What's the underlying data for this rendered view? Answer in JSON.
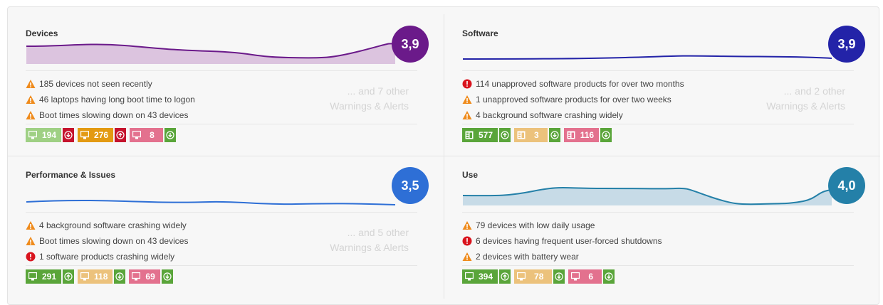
{
  "colors": {
    "devices_score": "#6b1a8a",
    "software_score": "#2323a8",
    "performance_score": "#2e6fd6",
    "use_score": "#2480a8",
    "warning": "#ef8b1c",
    "error": "#d9141e",
    "green": "#5aa53a",
    "light_green": "#9fd084",
    "orange": "#e39a12",
    "pink": "#e3718e",
    "light_orange": "#ecc27c",
    "red": "#c5132d"
  },
  "cards": [
    {
      "title": "Devices",
      "score": "3,9",
      "alerts": [
        {
          "level": "warning",
          "icon": "warning-icon",
          "text": "185 devices not seen recently"
        },
        {
          "level": "warning",
          "icon": "warning-icon",
          "text": "46 laptops having long boot time to logon"
        },
        {
          "level": "warning",
          "icon": "warning-icon",
          "text": "Boot times slowing down on 43 devices"
        }
      ],
      "more_count": "... and 7 other",
      "more_label": "Warnings & Alerts",
      "badges": [
        {
          "value": "194",
          "icon": "device-icon",
          "trend": "down",
          "trend_icon": "arrow-down-circle-icon",
          "color": "#9fd084",
          "trend_color": "#c5132d"
        },
        {
          "value": "276",
          "icon": "device-icon",
          "trend": "up",
          "trend_icon": "arrow-up-circle-icon",
          "color": "#e39a12",
          "trend_color": "#c5132d"
        },
        {
          "value": "8",
          "icon": "device-icon",
          "trend": "down",
          "trend_icon": "arrow-down-circle-icon",
          "color": "#e3718e",
          "trend_color": "#5aa53a"
        }
      ]
    },
    {
      "title": "Software",
      "score": "3,9",
      "alerts": [
        {
          "level": "error",
          "icon": "error-icon",
          "text": "114 unapproved software products for over two months"
        },
        {
          "level": "warning",
          "icon": "warning-icon",
          "text": "1 unapproved software products for over two weeks"
        },
        {
          "level": "warning",
          "icon": "warning-icon",
          "text": "4 background software crashing widely"
        }
      ],
      "more_count": "... and 2 other",
      "more_label": "Warnings & Alerts",
      "badges": [
        {
          "value": "577",
          "icon": "software-icon",
          "trend": "up",
          "trend_icon": "arrow-up-circle-icon",
          "color": "#5aa53a",
          "trend_color": "#5aa53a"
        },
        {
          "value": "3",
          "icon": "software-icon",
          "trend": "down",
          "trend_icon": "arrow-down-circle-icon",
          "color": "#ecc27c",
          "trend_color": "#5aa53a"
        },
        {
          "value": "116",
          "icon": "software-icon",
          "trend": "down",
          "trend_icon": "arrow-down-circle-icon",
          "color": "#e3718e",
          "trend_color": "#5aa53a"
        }
      ]
    },
    {
      "title": "Performance & Issues",
      "score": "3,5",
      "alerts": [
        {
          "level": "warning",
          "icon": "warning-icon",
          "text": "4 background software crashing widely"
        },
        {
          "level": "warning",
          "icon": "warning-icon",
          "text": "Boot times slowing down on 43 devices"
        },
        {
          "level": "error",
          "icon": "error-icon",
          "text": "1 software products crashing widely"
        }
      ],
      "more_count": "... and 5 other",
      "more_label": "Warnings & Alerts",
      "badges": [
        {
          "value": "291",
          "icon": "device-icon",
          "trend": "up",
          "trend_icon": "arrow-up-circle-icon",
          "color": "#5aa53a",
          "trend_color": "#5aa53a"
        },
        {
          "value": "118",
          "icon": "device-icon",
          "trend": "down",
          "trend_icon": "arrow-down-circle-icon",
          "color": "#ecc27c",
          "trend_color": "#5aa53a"
        },
        {
          "value": "69",
          "icon": "device-icon",
          "trend": "down",
          "trend_icon": "arrow-down-circle-icon",
          "color": "#e3718e",
          "trend_color": "#5aa53a"
        }
      ]
    },
    {
      "title": "Use",
      "score": "4,0",
      "alerts": [
        {
          "level": "warning",
          "icon": "warning-icon",
          "text": "79 devices with low daily usage"
        },
        {
          "level": "error",
          "icon": "error-icon",
          "text": "6 devices having frequent user-forced shutdowns"
        },
        {
          "level": "warning",
          "icon": "warning-icon",
          "text": "2 devices with battery wear"
        }
      ],
      "badges": [
        {
          "value": "394",
          "icon": "device-icon",
          "trend": "up",
          "trend_icon": "arrow-up-circle-icon",
          "color": "#5aa53a",
          "trend_color": "#5aa53a"
        },
        {
          "value": "78",
          "icon": "device-icon",
          "trend": "down",
          "trend_icon": "arrow-down-circle-icon",
          "color": "#ecc27c",
          "trend_color": "#5aa53a"
        },
        {
          "value": "6",
          "icon": "device-icon",
          "trend": "down",
          "trend_icon": "arrow-down-circle-icon",
          "color": "#e3718e",
          "trend_color": "#5aa53a"
        }
      ]
    }
  ]
}
